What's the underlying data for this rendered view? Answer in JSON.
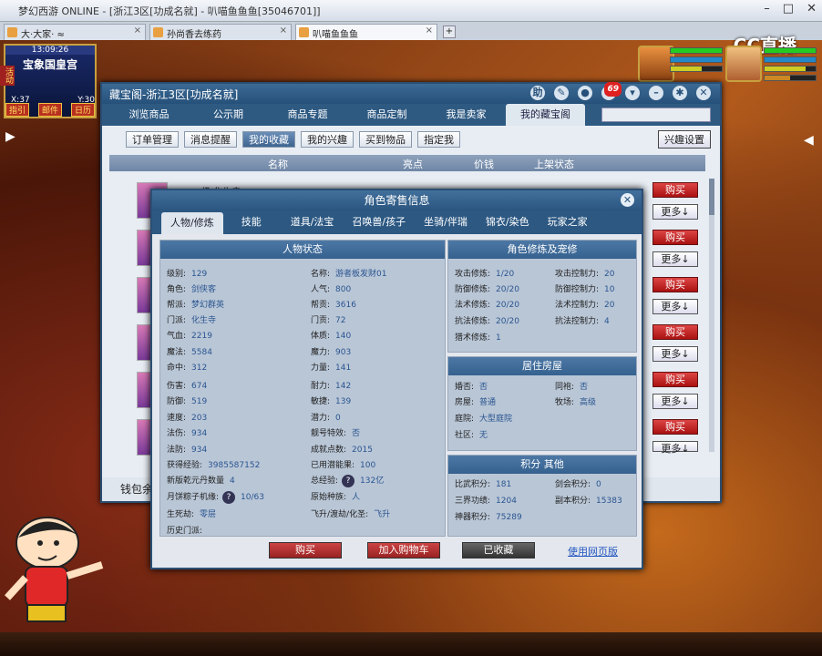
{
  "window": {
    "title": "梦幻西游 ONLINE - [浙江3区[功成名就] - 叭喵鱼鱼鱼[35046701]]",
    "controls": [
      "–",
      "□",
      "✕"
    ]
  },
  "browser_tabs": [
    {
      "label": "大·大家· ≈"
    },
    {
      "label": "孙尚香去练药"
    },
    {
      "label": "叭喵鱼鱼鱼"
    }
  ],
  "brand": "CC直播",
  "minimap": {
    "time": "13:09:26",
    "location": "宝象国皇宫",
    "x": "X:37",
    "y": "Y:30",
    "buttons": [
      "指引",
      "邮件",
      "日历"
    ],
    "side": "活动"
  },
  "store": {
    "title": "藏宝阁-浙江3区[功成名就]",
    "badge": "69",
    "nav_tabs": [
      "浏览商品",
      "公示期",
      "商品专题",
      "商品定制",
      "我是卖家",
      "我的藏宝阁"
    ],
    "sub_tabs": [
      "订单管理",
      "消息提醒",
      "我的收藏",
      "我的兴趣",
      "买到物品",
      "指定我"
    ],
    "interest_settings": "兴趣设置",
    "columns": [
      "名称",
      "亮点",
      "价钱",
      "上架状态"
    ],
    "first_row_text": "129级 化生寺",
    "buy": "购买",
    "more": "更多↓",
    "wallet": "钱包余"
  },
  "modal": {
    "title": "角色寄售信息",
    "tabs": [
      "人物/修炼",
      "技能",
      "道具/法宝",
      "召唤兽/孩子",
      "坐骑/伴瑞",
      "锦衣/染色",
      "玩家之家"
    ],
    "sections": {
      "status": "人物状态",
      "cultivation": "角色修炼及宠修",
      "residence": "居住房屋",
      "points": "积分 其他"
    },
    "left_col": [
      [
        "级别:",
        "129"
      ],
      [
        "角色:",
        "剑侠客"
      ],
      [
        "帮派:",
        "梦幻群英"
      ],
      [
        "门派:",
        "化生寺"
      ],
      [
        "气血:",
        "2219"
      ],
      [
        "魔法:",
        "5584"
      ],
      [
        "命中:",
        "312"
      ],
      [
        "伤害:",
        "674"
      ],
      [
        "防御:",
        "519"
      ],
      [
        "速度:",
        "203"
      ],
      [
        "法伤:",
        "934"
      ],
      [
        "法防:",
        "934"
      ]
    ],
    "mid_col": [
      [
        "名称:",
        "游者板发财01"
      ],
      [
        "人气:",
        "800"
      ],
      [
        "帮贡:",
        "3616"
      ],
      [
        "门贡:",
        "72"
      ],
      [
        "体质:",
        "140"
      ],
      [
        "魔力:",
        "903"
      ],
      [
        "力量:",
        "141"
      ],
      [
        "耐力:",
        "142"
      ],
      [
        "敏捷:",
        "139"
      ],
      [
        "潜力:",
        "0"
      ],
      [
        "靓号特效:",
        "否"
      ],
      [
        "成就点数:",
        "2015"
      ]
    ],
    "bottom_left": [
      [
        "获得经验:",
        "3985587152"
      ],
      [
        "新版乾元丹数量",
        "4"
      ],
      [
        "月饼粽子机缘:",
        "10/63"
      ],
      [
        "生死劫:",
        "零层"
      ],
      [
        "历史门派:",
        ""
      ]
    ],
    "bottom_mid": [
      [
        "已用潜能果:",
        "100"
      ],
      [
        "总经验:",
        "132亿"
      ],
      [
        "原始种族:",
        "人"
      ],
      [
        "飞升/渡劫/化圣:",
        "飞升"
      ]
    ],
    "cult": [
      [
        "攻击修炼:",
        "1/20",
        "攻击控制力:",
        "20"
      ],
      [
        "防御修炼:",
        "20/20",
        "防御控制力:",
        "10"
      ],
      [
        "法术修炼:",
        "20/20",
        "法术控制力:",
        "20"
      ],
      [
        "抗法修炼:",
        "20/20",
        "抗法控制力:",
        "4"
      ],
      [
        "猎术修炼:",
        "1",
        "",
        ""
      ]
    ],
    "house": [
      [
        "婚否:",
        "否",
        "同袍:",
        "否"
      ],
      [
        "房屋:",
        "普通",
        "牧场:",
        "高级"
      ],
      [
        "庭院:",
        "大型庭院",
        "",
        ""
      ],
      [
        "社区:",
        "无",
        "",
        ""
      ]
    ],
    "points": [
      [
        "比武积分:",
        "181",
        "剑会积分:",
        "0"
      ],
      [
        "三界功绩:",
        "1204",
        "副本积分:",
        "15383"
      ],
      [
        "神器积分:",
        "75289",
        "",
        ""
      ]
    ],
    "buttons": {
      "buy": "购买",
      "add_cart": "加入购物车",
      "favorited": "已收藏",
      "web": "使用网页版"
    }
  }
}
